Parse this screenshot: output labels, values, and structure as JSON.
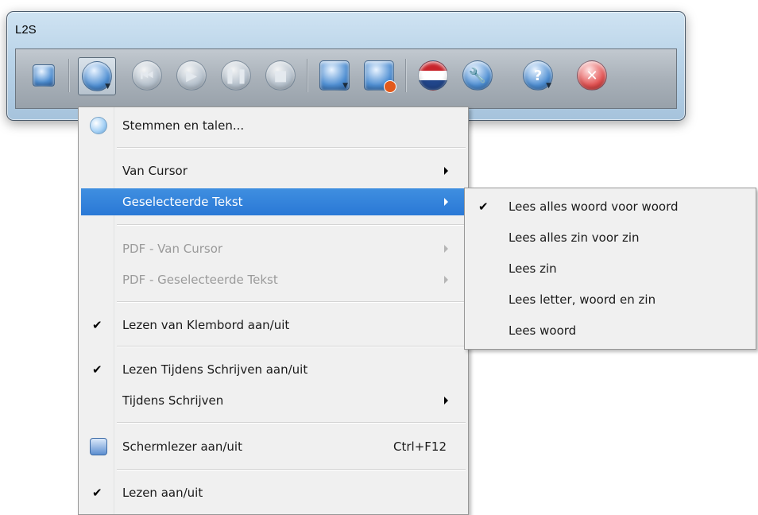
{
  "window": {
    "title": "L2S"
  },
  "toolbar": {
    "buttons": [
      {
        "name": "voices",
        "icon": "voices-icon"
      },
      {
        "name": "speak",
        "icon": "speech-bubble-icon",
        "active": true
      },
      {
        "name": "previous",
        "icon": "previous-icon",
        "disabled": true
      },
      {
        "name": "play",
        "icon": "play-icon",
        "disabled": true
      },
      {
        "name": "pause",
        "icon": "pause-icon",
        "disabled": true
      },
      {
        "name": "stop",
        "icon": "stop-icon",
        "disabled": true
      },
      {
        "name": "save-audio",
        "icon": "document-audio-icon"
      },
      {
        "name": "record",
        "icon": "record-document-icon"
      },
      {
        "name": "language",
        "icon": "dutch-flag-icon"
      },
      {
        "name": "settings",
        "icon": "wrench-icon"
      },
      {
        "name": "help",
        "icon": "help-icon",
        "glyph": "?"
      },
      {
        "name": "close",
        "icon": "close-icon",
        "glyph": "✕"
      }
    ]
  },
  "menu": {
    "items": [
      {
        "label": "Stemmen en talen...",
        "icon": "voices-icon"
      },
      {
        "label": "Van Cursor",
        "submenu": true
      },
      {
        "label": "Geselecteerde Tekst",
        "submenu": true,
        "highlighted": true
      },
      {
        "label": "PDF - Van Cursor",
        "submenu": true,
        "disabled": true
      },
      {
        "label": "PDF - Geselecteerde Tekst",
        "submenu": true,
        "disabled": true
      },
      {
        "label": "Lezen van Klembord aan/uit",
        "checked": true
      },
      {
        "label": "Lezen Tijdens Schrijven aan/uit",
        "checked": true
      },
      {
        "label": "Tijdens Schrijven",
        "submenu": true
      },
      {
        "label": "Schermlezer aan/uit",
        "shortcut": "Ctrl+F12",
        "icon": "screen-reader-icon"
      },
      {
        "label": "Lezen aan/uit",
        "checked": true
      }
    ]
  },
  "submenu": {
    "items": [
      {
        "label": "Lees alles woord voor woord",
        "checked": true
      },
      {
        "label": "Lees alles zin voor zin"
      },
      {
        "label": "Lees zin"
      },
      {
        "label": "Lees letter, woord en zin"
      },
      {
        "label": "Lees woord"
      }
    ]
  },
  "colors": {
    "highlight": "#2a78d6",
    "menu_background": "#f0f0f0",
    "disabled_text": "#9a9a9a"
  }
}
